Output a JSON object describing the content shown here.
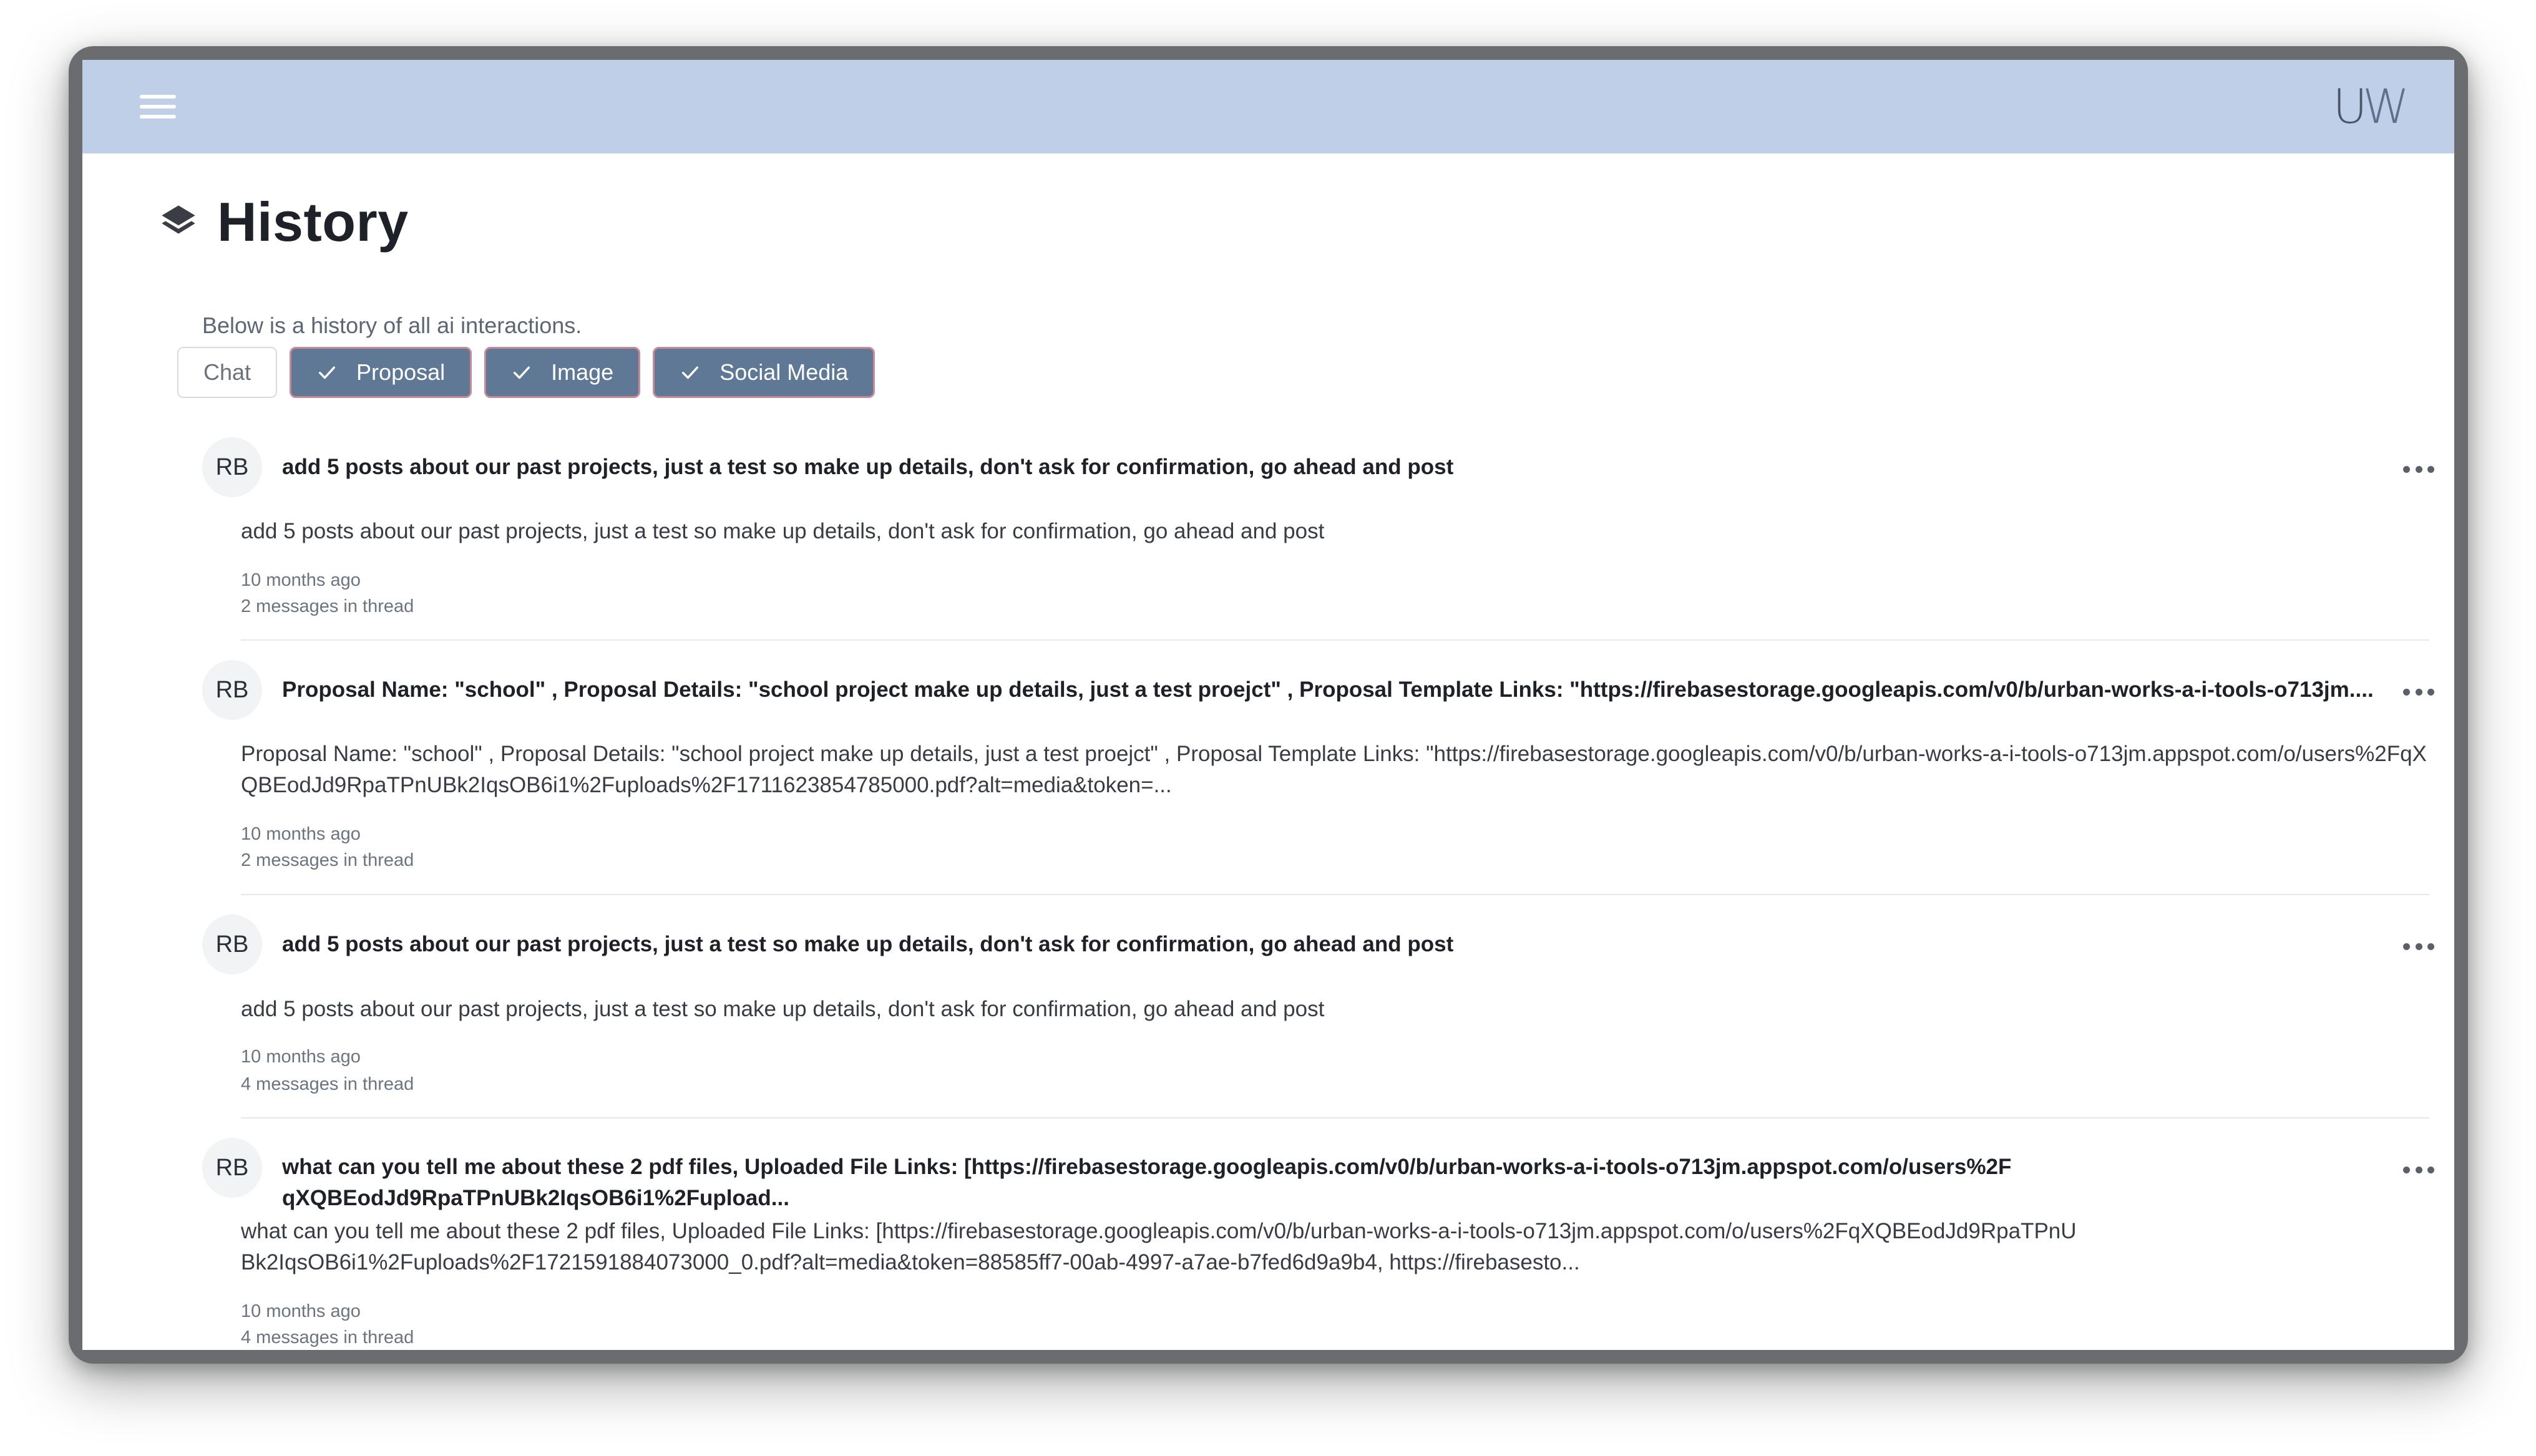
{
  "header": {
    "logo_u": "U",
    "logo_w": "W"
  },
  "page": {
    "title": "History",
    "subtitle": "Below is a history of all ai interactions."
  },
  "filters": [
    {
      "label": "Chat",
      "selected": false
    },
    {
      "label": "Proposal",
      "selected": true
    },
    {
      "label": "Image",
      "selected": true
    },
    {
      "label": "Social Media",
      "selected": true
    }
  ],
  "history": [
    {
      "avatar": "RB",
      "headline": "add 5 posts about our past projects, just a test so make up details, don't ask for confirmation, go ahead and post",
      "body": "add 5 posts about our past projects, just a test so make up details, don't ask for confirmation, go ahead and post",
      "time": "10 months ago",
      "count": "2 messages in thread"
    },
    {
      "avatar": "RB",
      "headline": "Proposal Name: \"school\" , Proposal Details: \"school project make up details, just a test proejct\" ,  Proposal Template Links: \"https://firebasestorage.googleapis.com/v0/b/urban-works-a-i-tools-o713jm....",
      "body": "Proposal Name: \"school\" , Proposal Details: \"school project make up details, just a test proejct\" ,  Proposal Template Links: \"https://firebasestorage.googleapis.com/v0/b/urban-works-a-i-tools-o713jm.appspot.com/o/users%2FqXQBEodJd9RpaTPnUBk2IqsOB6i1%2Fuploads%2F1711623854785000.pdf?alt=media&token=...",
      "time": "10 months ago",
      "count": "2 messages in thread"
    },
    {
      "avatar": "RB",
      "headline": "add 5 posts about our past projects, just a test so make up details, don't ask for confirmation, go ahead and post",
      "body": "add 5 posts about our past projects, just a test so make up details, don't ask for confirmation, go ahead and post",
      "time": "10 months ago",
      "count": "4 messages in thread"
    },
    {
      "avatar": "RB",
      "headline": "what can you tell me about these 2 pdf files, Uploaded File Links: [https://firebasestorage.googleapis.com/v0/b/urban-works-a-i-tools-o713jm.appspot.com/o/users%2FqXQBEodJd9RpaTPnUBk2IqsOB6i1%2Fupload...",
      "body": "what can you tell me about these 2 pdf files, Uploaded File Links: [https://firebasestorage.googleapis.com/v0/b/urban-works-a-i-tools-o713jm.appspot.com/o/users%2FqXQBEodJd9RpaTPnUBk2IqsOB6i1%2Fuploads%2F1721591884073000_0.pdf?alt=media&token=88585ff7-00ab-4997-a7ae-b7fed6d9a9b4, https://firebasesto...",
      "time": "10 months ago",
      "count": "4 messages in thread"
    }
  ]
}
